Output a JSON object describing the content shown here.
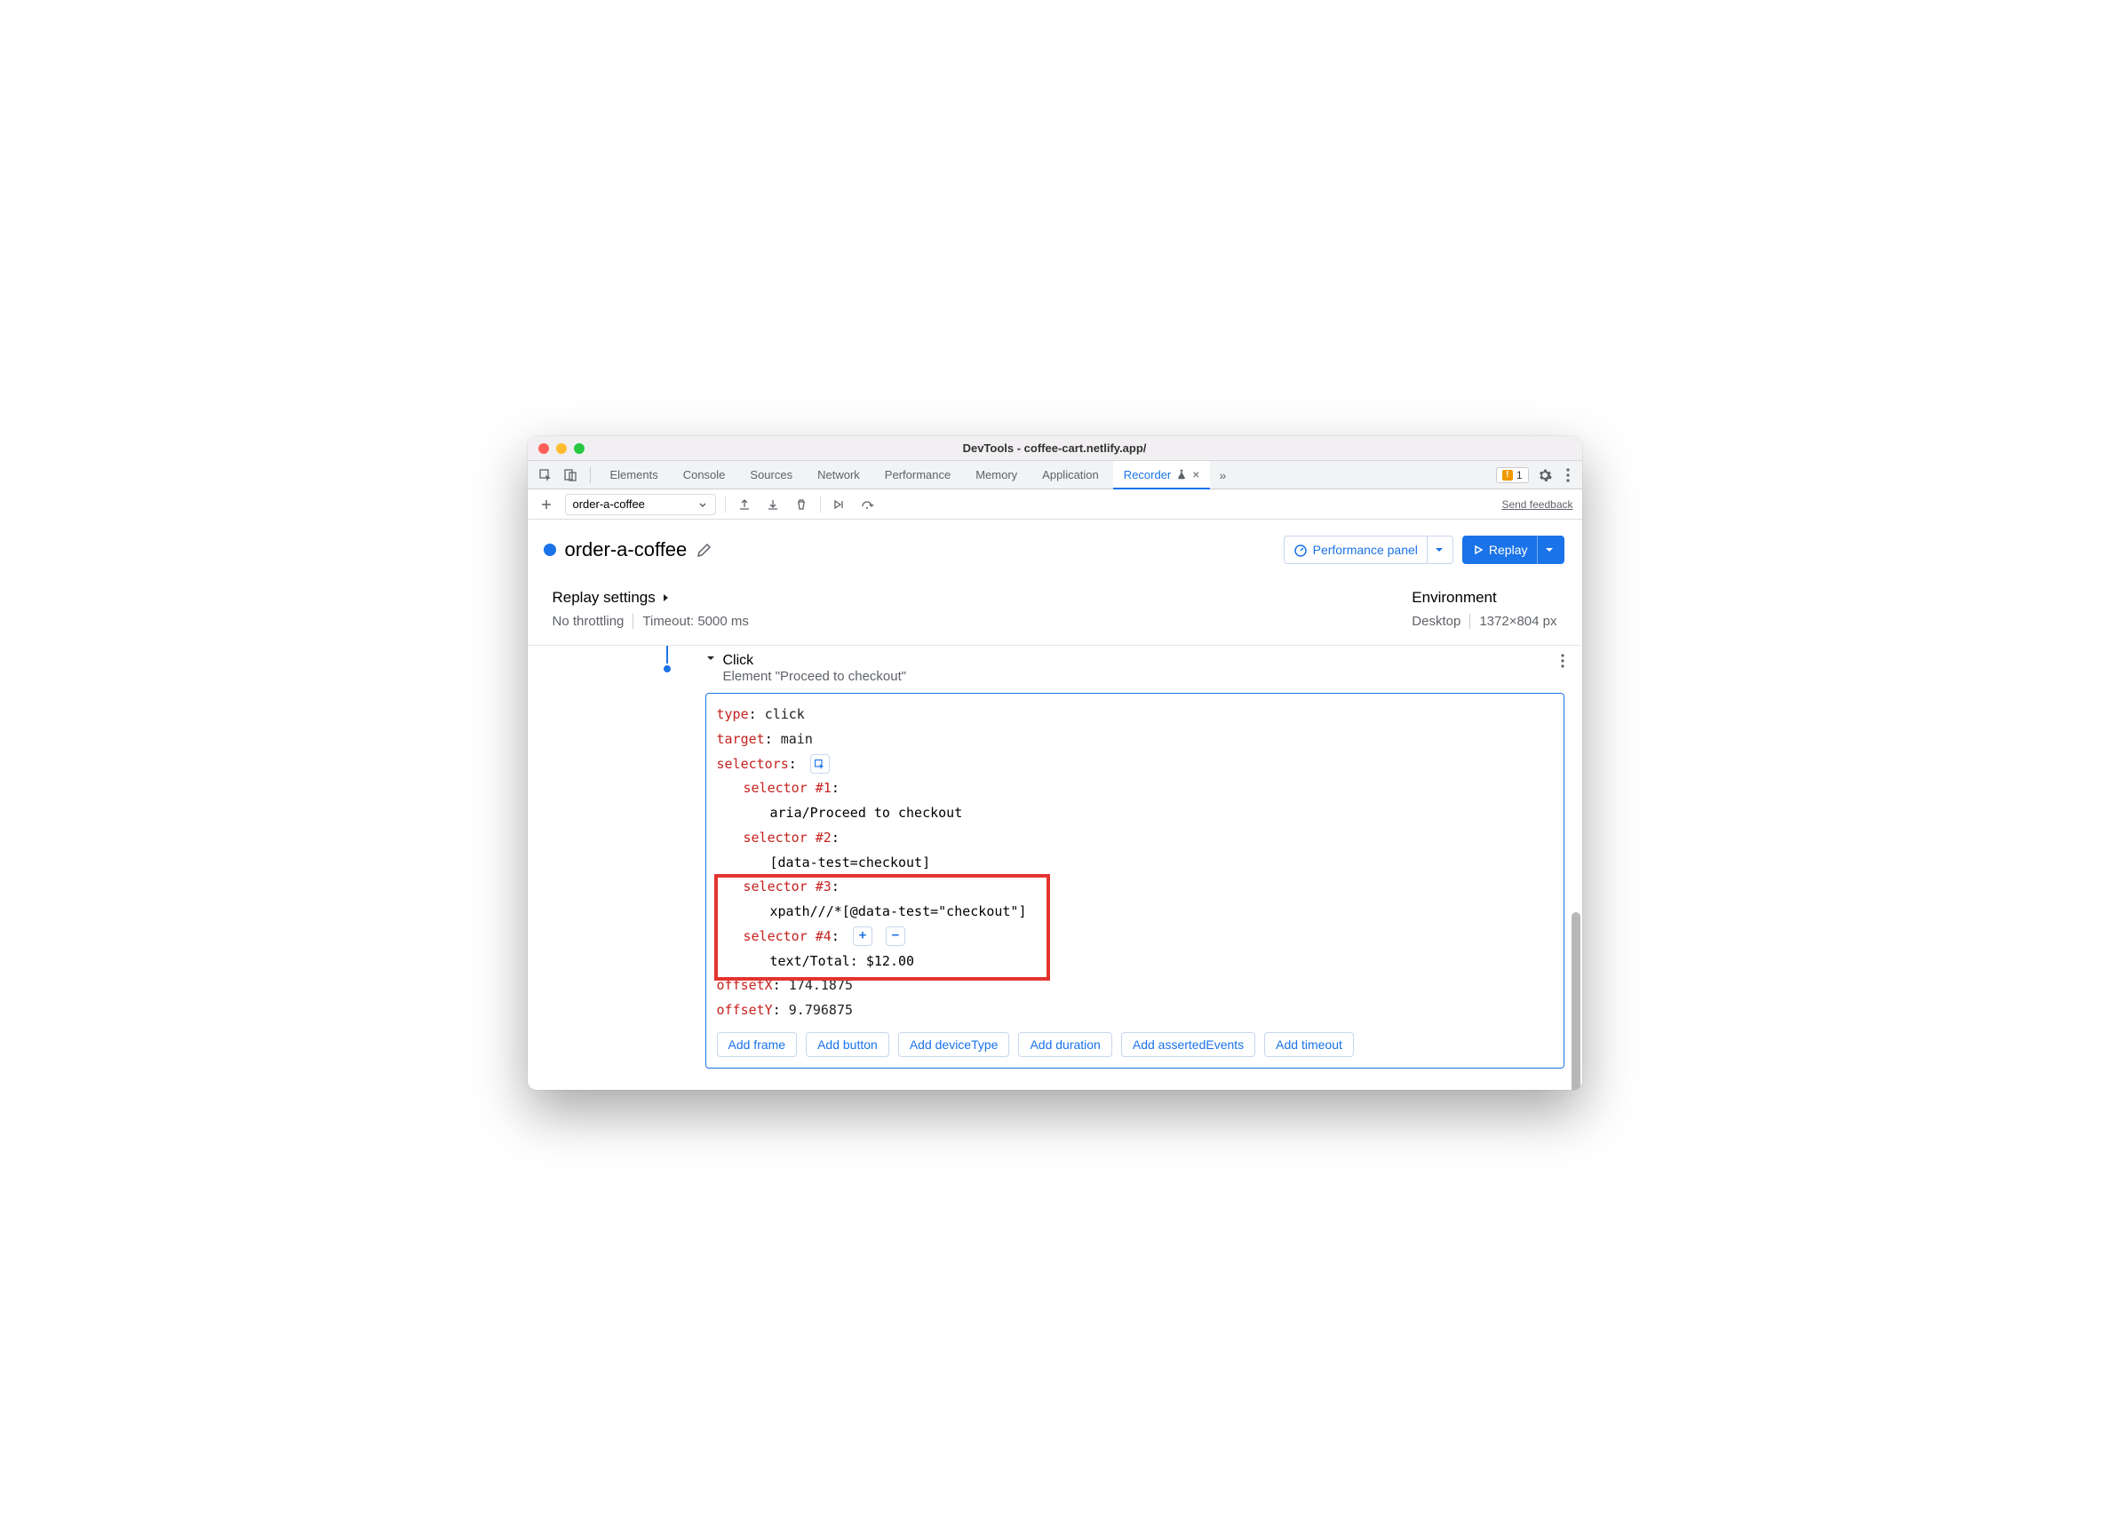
{
  "window": {
    "title": "DevTools - coffee-cart.netlify.app/"
  },
  "tabs": {
    "items": [
      "Elements",
      "Console",
      "Sources",
      "Network",
      "Performance",
      "Memory",
      "Application",
      "Recorder"
    ],
    "warn_count": "1"
  },
  "toolbar": {
    "recording_name": "order-a-coffee",
    "feedback": "Send feedback"
  },
  "recording": {
    "title": "order-a-coffee",
    "perf_button": "Performance panel",
    "replay_button": "Replay"
  },
  "settings": {
    "replay_label": "Replay settings",
    "throttling": "No throttling",
    "timeout": "Timeout: 5000 ms",
    "env_label": "Environment",
    "device": "Desktop",
    "dimensions": "1372×804 px"
  },
  "step": {
    "title": "Click",
    "subtitle": "Element \"Proceed to checkout\"",
    "type_key": "type",
    "type_val": "click",
    "target_key": "target",
    "target_val": "main",
    "selectors_key": "selectors",
    "sel1_key": "selector #1",
    "sel1_val": "aria/Proceed to checkout",
    "sel2_key": "selector #2",
    "sel2_val": "[data-test=checkout]",
    "sel3_key": "selector #3",
    "sel3_val": "xpath///*[@data-test=\"checkout\"]",
    "sel4_key": "selector #4",
    "sel4_val": "text/Total: $12.00",
    "offx_key": "offsetX",
    "offx_val": "174.1875",
    "offy_key": "offsetY",
    "offy_val": "9.796875",
    "add": {
      "frame": "Add frame",
      "button": "Add button",
      "deviceType": "Add deviceType",
      "duration": "Add duration",
      "assertedEvents": "Add assertedEvents",
      "timeout": "Add timeout"
    }
  }
}
